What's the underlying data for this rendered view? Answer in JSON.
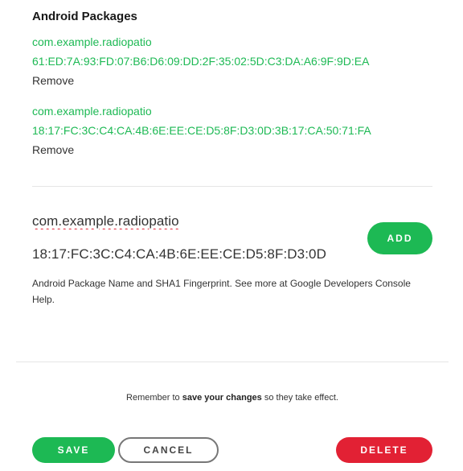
{
  "section": {
    "title": "Android Packages"
  },
  "packages": [
    {
      "name": "com.example.radiopatio",
      "sha1": "61:ED:7A:93:FD:07:B6:D6:09:DD:2F:35:02:5D:C3:DA:A6:9F:9D:EA",
      "remove_label": "Remove"
    },
    {
      "name": "com.example.radiopatio",
      "sha1": "18:17:FC:3C:C4:CA:4B:6E:EE:CE:D5:8F:D3:0D:3B:17:CA:50:71:FA",
      "remove_label": "Remove"
    }
  ],
  "new_package": {
    "name_value": "com.example.radiopatio",
    "sha1_value": "18:17:FC:3C:C4:CA:4B:6E:EE:CE:D5:8F:D3:0D",
    "add_label": "ADD",
    "help_text": "Android Package Name and SHA1 Fingerprint. See more at Google Developers Console Help."
  },
  "footer": {
    "reminder_prefix": "Remember to ",
    "reminder_bold": "save your changes",
    "reminder_suffix": " so they take effect.",
    "save_label": "SAVE",
    "cancel_label": "CANCEL",
    "delete_label": "DELETE"
  },
  "colors": {
    "accent_green": "#1db954",
    "danger_red": "#e22134"
  }
}
